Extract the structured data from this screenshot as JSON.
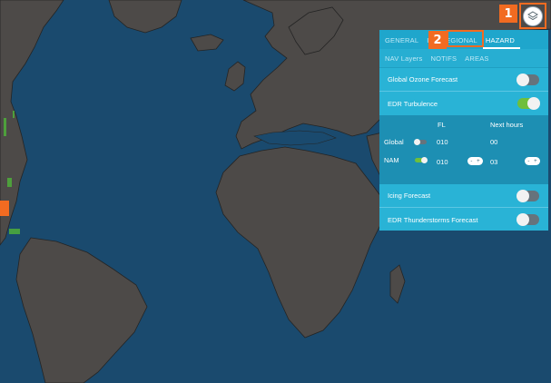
{
  "steps": {
    "one": "1",
    "two": "2"
  },
  "layers_button": {
    "icon": "layers-icon"
  },
  "panel": {
    "tabs_row1": [
      "GENERAL",
      "I",
      "REGIONAL",
      "HAZARD"
    ],
    "tabs_row2": [
      "NAV Layers",
      "NOTIFS",
      "AREAS"
    ],
    "active_tab": "HAZARD",
    "rows": {
      "ozone": {
        "label": "Global Ozone Forecast",
        "on": false
      },
      "edr": {
        "label": "EDR Turbulence",
        "on": true
      },
      "icing": {
        "label": "Icing Forecast",
        "on": false
      },
      "thunder": {
        "label": "EDR Thunderstorms Forecast",
        "on": false
      }
    },
    "edr_table": {
      "col_fl": "FL",
      "col_next": "Next hours",
      "global": {
        "label": "Global",
        "fl": "010",
        "next": "00",
        "on": false
      },
      "nam": {
        "label": "NAM",
        "fl": "010",
        "next": "03",
        "on": true
      }
    },
    "stepper": {
      "minus": "-",
      "plus": "+"
    }
  },
  "colors": {
    "ocean": "#1a4a6e",
    "land": "#4d4a48",
    "border": "#242424",
    "panel": "#29b3d6",
    "accent": "#f26b21",
    "toggle_on": "#6fbf3b"
  }
}
